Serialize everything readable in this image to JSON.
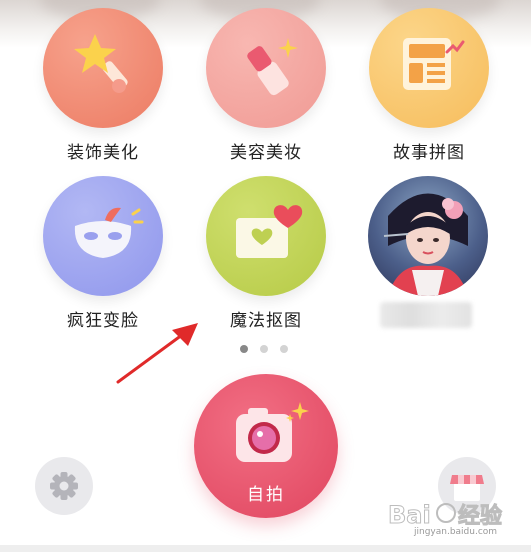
{
  "features": [
    {
      "label": "装饰美化",
      "icon": "star-wand-icon",
      "color": "#ef8569"
    },
    {
      "label": "美容美妆",
      "icon": "lipstick-icon",
      "color": "#f3a29c"
    },
    {
      "label": "故事拼图",
      "icon": "collage-icon",
      "color": "#f8c56b"
    },
    {
      "label": "疯狂变脸",
      "icon": "mask-icon",
      "color": "#9aa0ee"
    },
    {
      "label": "魔法抠图",
      "icon": "heart-photo-icon",
      "color": "#bed052"
    },
    {
      "label": "",
      "icon": "avatar-feature-icon"
    }
  ],
  "pager": {
    "total": 3,
    "active": 0,
    "active_color": "#888888",
    "inactive_color": "#d3d3d3"
  },
  "selfie": {
    "label": "自拍",
    "icon": "camera-icon",
    "color": "#e9536c"
  },
  "settings": {
    "icon": "gear-icon"
  },
  "store": {
    "icon": "store-icon"
  },
  "annotation": {
    "icon": "red-arrow-icon",
    "color": "#e02a2a"
  },
  "watermark": {
    "text": "Bai 经验",
    "sub": "jingyan.baidu.com"
  }
}
